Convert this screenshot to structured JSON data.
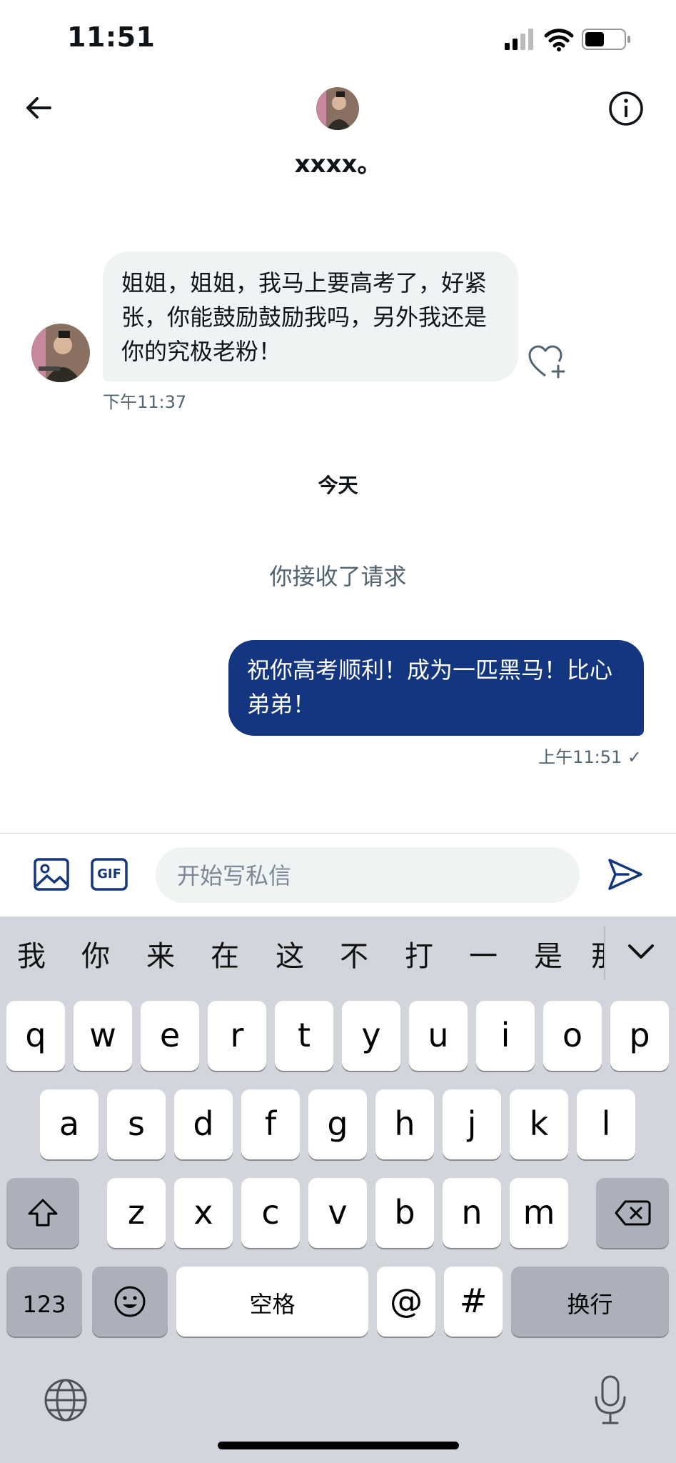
{
  "status_bar": {
    "time": "11:51"
  },
  "header": {
    "name": "xxxx。",
    "back_icon": "arrow-left-icon",
    "info_icon": "info-icon"
  },
  "conversation": {
    "incoming": {
      "text": "姐姐，姐姐，我马上要高考了，好紧张，你能鼓励鼓励我吗，另外我还是你的究极老粉！",
      "time": "下午11:37"
    },
    "day_separator": "今天",
    "system_notice": "你接收了请求",
    "outgoing": {
      "text": "祝你高考顺利！成为一匹黑马！比心 弟弟！",
      "time": "上午11:51 ✓"
    }
  },
  "composer": {
    "placeholder": "开始写私信",
    "value": "",
    "gif_label": "GIF"
  },
  "keyboard": {
    "candidates": [
      "我",
      "你",
      "来",
      "在",
      "这",
      "不",
      "打",
      "一",
      "是",
      "那"
    ],
    "row1": [
      "q",
      "w",
      "e",
      "r",
      "t",
      "y",
      "u",
      "i",
      "o",
      "p"
    ],
    "row2": [
      "a",
      "s",
      "d",
      "f",
      "g",
      "h",
      "j",
      "k",
      "l"
    ],
    "row3": [
      "z",
      "x",
      "c",
      "v",
      "b",
      "n",
      "m"
    ],
    "numbers_label": "123",
    "space_label": "空格",
    "at_label": "@",
    "hash_label": "#",
    "return_label": "换行"
  },
  "colors": {
    "accent": "#14357f",
    "incoming_bubble": "#eff3f4",
    "muted": "#536471",
    "keyboard_bg": "#d2d5db"
  }
}
